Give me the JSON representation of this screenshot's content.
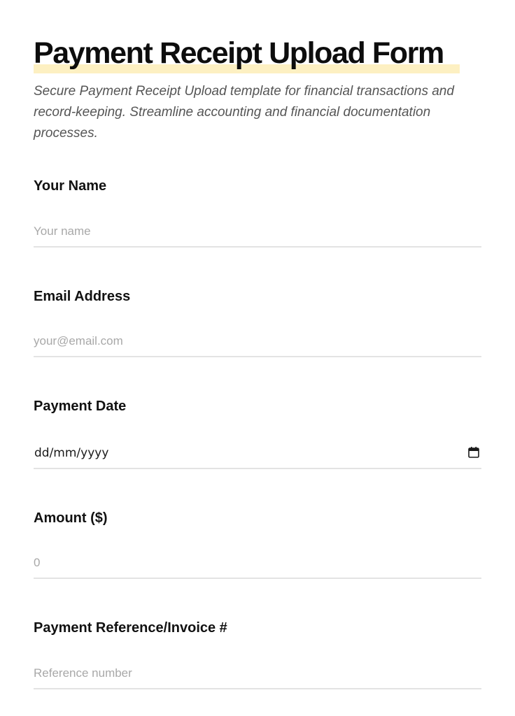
{
  "form": {
    "title": "Payment Receipt Upload Form",
    "description": "Secure Payment Receipt Upload template for financial transactions and record-keeping. Streamline accounting and financial documentation processes.",
    "fields": [
      {
        "label": "Your Name",
        "placeholder": "Your name"
      },
      {
        "label": "Email Address",
        "placeholder": "your@email.com"
      },
      {
        "label": "Payment Date",
        "value": "dd/mm/yyyy",
        "icon": "calendar-icon"
      },
      {
        "label": "Amount ($)",
        "placeholder": "0"
      },
      {
        "label": "Payment Reference/Invoice #",
        "placeholder": "Reference number"
      }
    ]
  },
  "colors": {
    "title_highlight": "#fdf0c2",
    "divider": "#e3e3e3",
    "placeholder": "#a8a8a8",
    "description": "#555555"
  }
}
